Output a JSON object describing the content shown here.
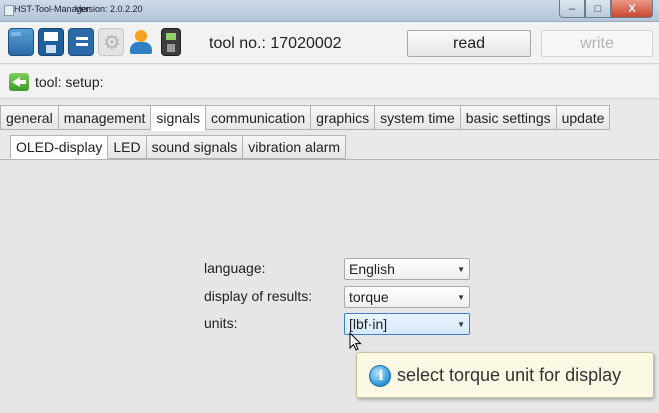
{
  "window": {
    "title": "HST-Tool-Manager",
    "version": "Version: 2.0.2.20",
    "minimize": "–",
    "maximize": "□",
    "close": "X"
  },
  "toolbar": {
    "tool_no_label": "tool no.: 17020002",
    "read_label": "read",
    "write_label": "write",
    "icons": [
      "folder-icon",
      "save-icon",
      "list-icon",
      "gear-icon",
      "user-icon",
      "device-icon"
    ]
  },
  "breadcrumb": {
    "text": "tool: setup:"
  },
  "tabs": [
    "general",
    "management",
    "signals",
    "communication",
    "graphics",
    "system time",
    "basic settings",
    "update"
  ],
  "active_tab": "signals",
  "subtabs": [
    "OLED-display",
    "LED",
    "sound signals",
    "vibration alarm"
  ],
  "active_subtab": "OLED-display",
  "form": {
    "language_label": "language:",
    "language_value": "English",
    "results_label": "display of results:",
    "results_value": "torque",
    "units_label": "units:",
    "units_value": "[lbf·in]"
  },
  "tooltip": {
    "text": "select torque unit for display"
  }
}
